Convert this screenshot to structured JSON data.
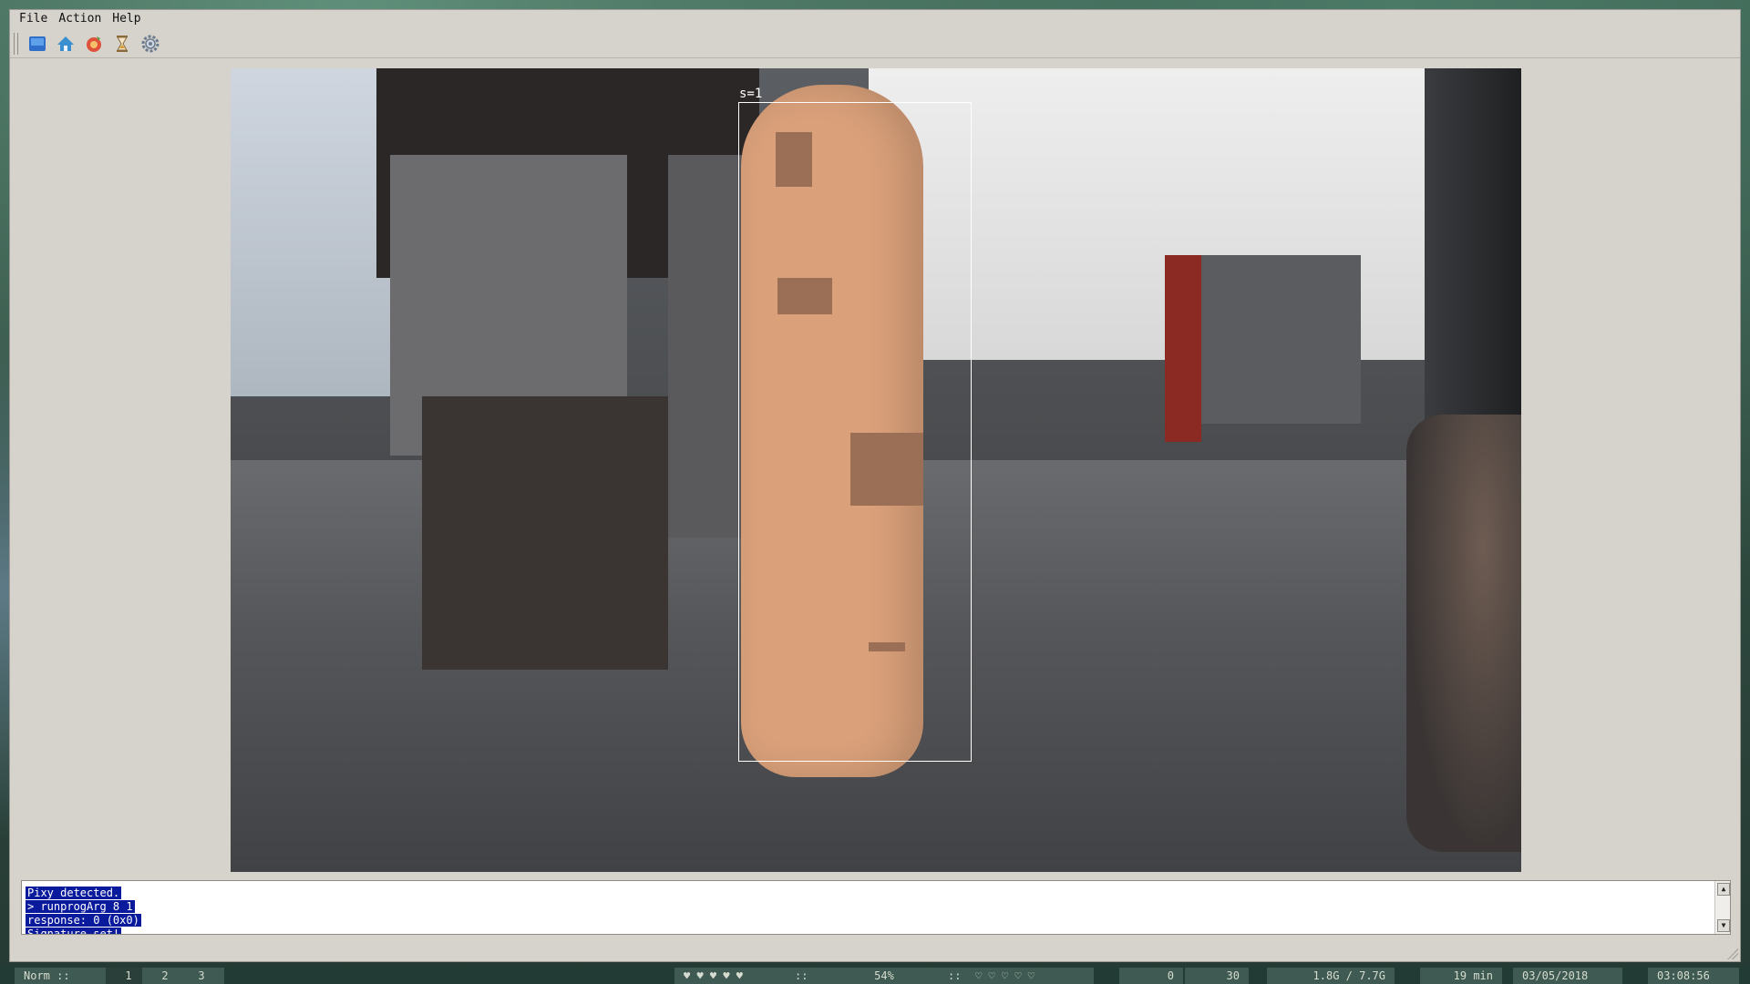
{
  "menubar": {
    "items": [
      "File",
      "Action",
      "Help"
    ]
  },
  "toolbar": {
    "buttons": [
      {
        "name": "raw-video-icon",
        "glyph": "▆"
      },
      {
        "name": "default-program-icon",
        "glyph": "⌂"
      },
      {
        "name": "set-signature-icon",
        "glyph": "◉"
      },
      {
        "name": "stop-icon",
        "glyph": "⌛"
      },
      {
        "name": "config-icon",
        "glyph": "⚙"
      }
    ]
  },
  "video": {
    "signature_label": "s=1"
  },
  "console": {
    "lines": [
      "Pixy detected.",
      "> runprogArg 8 1",
      "response: 0 (0x0)",
      "Signature set!"
    ]
  },
  "statusbar": {
    "mode": "Norm ::",
    "workspaces": [
      "1",
      "2",
      "3"
    ],
    "hearts": "♥ ♥ ♥ ♥ ♥",
    "sep1": "::",
    "volume_pct": "54%",
    "sep2": "::",
    "empty_hearts": "♡ ♡ ♡ ♡ ♡",
    "cpu": "0",
    "audio": "30",
    "memory": "1.8G / 7.7G",
    "battery": "19 min",
    "date": "03/05/2018",
    "time": "03:08:56"
  },
  "colors": {
    "window_bg": "#d6d3cc",
    "console_highlight": "#0a1a9c",
    "statusbar_bg": "#233b35",
    "signature_color": "#d9a07a"
  }
}
